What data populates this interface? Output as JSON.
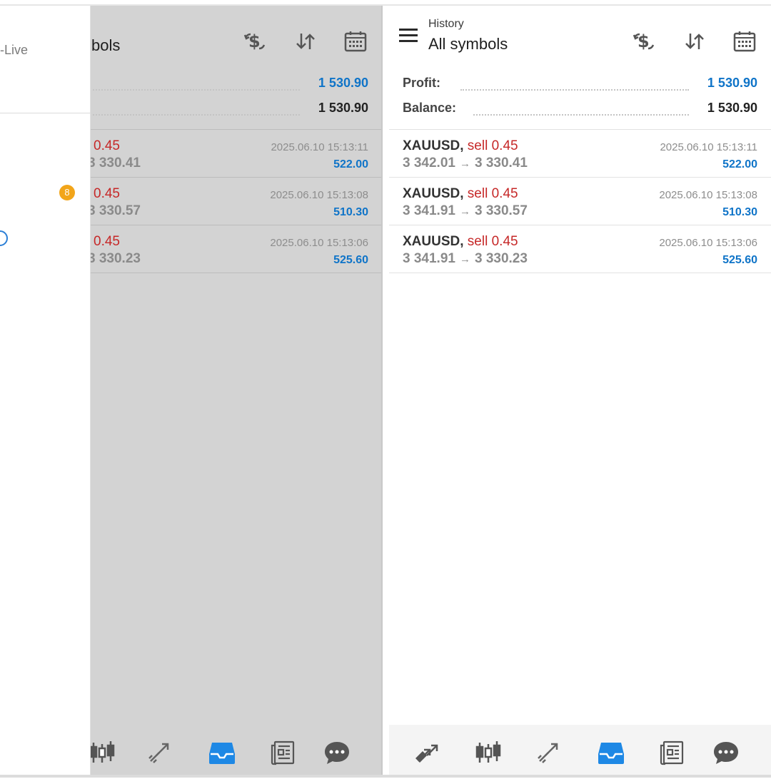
{
  "colors": {
    "accent": "#0f74c8",
    "sell": "#c62828",
    "badge": "#f2a51a",
    "dimmed_background": "#d3d3d3"
  },
  "left_panel": {
    "drawer": {
      "account_text": "-Live",
      "badge_count": "8"
    },
    "header": {
      "title_partial": "bols"
    },
    "summary": {
      "profit_value": "1 530.90",
      "balance_value": "1 530.90"
    },
    "deals": [
      {
        "vol": "0.45",
        "prices_partial": "3 330.41",
        "time": "2025.06.10 15:13:11",
        "profit": "522.00"
      },
      {
        "vol": "0.45",
        "prices_partial": "3 330.57",
        "time": "2025.06.10 15:13:08",
        "profit": "510.30"
      },
      {
        "vol": "0.45",
        "prices_partial": "3 330.23",
        "time": "2025.06.10 15:13:06",
        "profit": "525.60"
      }
    ]
  },
  "right_panel": {
    "header": {
      "subtitle": "History",
      "title": "All symbols"
    },
    "summary": {
      "profit_label": "Profit:",
      "profit_value": "1 530.90",
      "balance_label": "Balance:",
      "balance_value": "1 530.90"
    },
    "deals": [
      {
        "symbol": "XAUUSD,",
        "side": "sell",
        "vol": "0.45",
        "open": "3 342.01",
        "arrow": "→",
        "close": "3 330.41",
        "time": "2025.06.10 15:13:11",
        "profit": "522.00"
      },
      {
        "symbol": "XAUUSD,",
        "side": "sell",
        "vol": "0.45",
        "open": "3 341.91",
        "arrow": "→",
        "close": "3 330.57",
        "time": "2025.06.10 15:13:08",
        "profit": "510.30"
      },
      {
        "symbol": "XAUUSD,",
        "side": "sell",
        "vol": "0.45",
        "open": "3 341.91",
        "arrow": "→",
        "close": "3 330.23",
        "time": "2025.06.10 15:13:06",
        "profit": "525.60"
      }
    ]
  },
  "icons": {
    "toolbar": [
      "currency-icon",
      "sort-icon",
      "calendar-icon"
    ],
    "bottom_nav": [
      "quotes-icon",
      "chart-icon",
      "trade-icon",
      "history-icon",
      "news-icon",
      "chat-icon"
    ]
  }
}
